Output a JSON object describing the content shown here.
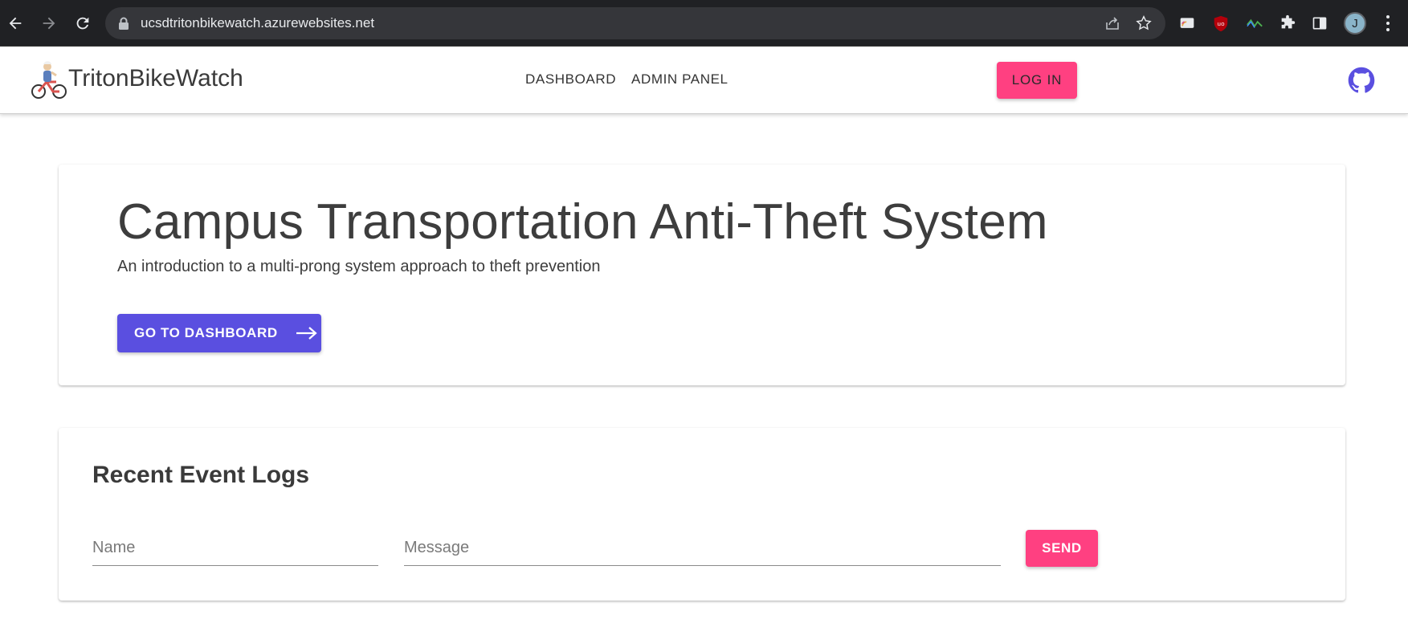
{
  "browser": {
    "url": "ucsdtritonbikewatch.azurewebsites.net",
    "profile_initial": "J",
    "icons": [
      "back-icon",
      "forward-icon",
      "reload-icon",
      "lock-icon",
      "share-icon",
      "star-icon",
      "extension-icon",
      "side-panel-icon",
      "more-icon"
    ]
  },
  "appbar": {
    "brand": "TritonBikeWatch",
    "nav": [
      "DASHBOARD",
      "ADMIN PANEL"
    ],
    "login_label": "LOG IN",
    "github_icon": "github-icon"
  },
  "hero": {
    "title": "Campus Transportation Anti-Theft System",
    "subtitle": "An introduction to a multi-prong system approach to theft prevention",
    "button_label": "GO TO DASHBOARD",
    "button_icon": "arrow-right-icon"
  },
  "logs": {
    "title": "Recent Event Logs",
    "name_placeholder": "Name",
    "message_placeholder": "Message",
    "send_label": "SEND"
  },
  "colors": {
    "chrome_bg": "#202124",
    "accent_pink": "#ff4081",
    "primary_indigo": "#5a4fe0",
    "github_purple": "#5a4fe0"
  }
}
